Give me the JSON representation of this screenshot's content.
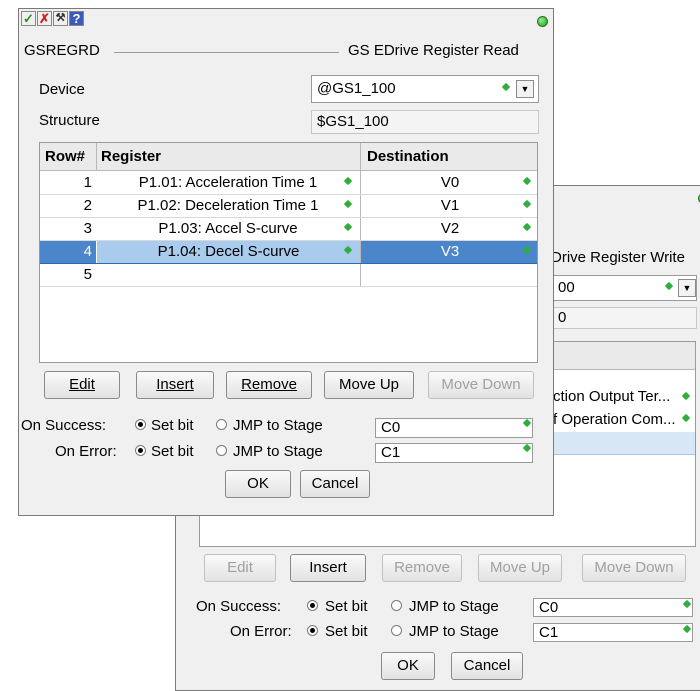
{
  "colors": {
    "accent": "#4a86c9",
    "status_green": "#2fae3c",
    "background": "#f0f0f0"
  },
  "back_dialog": {
    "title_partial": "Drive Register Write",
    "device_value": "00",
    "structure_value": "0",
    "rows": [
      {
        "register": "ction Output Ter..."
      },
      {
        "register": "f Operation Com..."
      }
    ],
    "buttons": {
      "edit": "Edit",
      "insert": "Insert",
      "remove": "Remove",
      "move_up": "Move Up",
      "move_down": "Move Down"
    },
    "on_success_label": "On Success:",
    "on_error_label": "On Error:",
    "set_bit": "Set bit",
    "jmp_to_stage": "JMP to Stage",
    "success_value": "C0",
    "error_value": "C1",
    "ok": "OK",
    "cancel": "Cancel"
  },
  "front_dialog": {
    "toolbar_icons": [
      "check-icon",
      "close-icon",
      "tools-icon",
      "help-icon"
    ],
    "toolbar_glyphs": {
      "check": "✓",
      "close": "✗",
      "tools": "⚒",
      "help": "?"
    },
    "instruction_name": "GSREGRD",
    "title": "GS EDrive Register Read",
    "device_label": "Device",
    "device_value": "@GS1_100",
    "structure_label": "Structure",
    "structure_value": "$GS1_100",
    "columns": {
      "row": "Row#",
      "register": "Register",
      "destination": "Destination"
    },
    "rows": [
      {
        "num": "1",
        "register": "P1.01: Acceleration Time 1",
        "destination": "V0"
      },
      {
        "num": "2",
        "register": "P1.02: Deceleration Time 1",
        "destination": "V1"
      },
      {
        "num": "3",
        "register": "P1.03: Accel S-curve",
        "destination": "V2"
      },
      {
        "num": "4",
        "register": "P1.04: Decel S-curve",
        "destination": "V3"
      },
      {
        "num": "5",
        "register": "",
        "destination": ""
      }
    ],
    "selected_row": "4",
    "buttons": {
      "edit": "Edit",
      "insert": "Insert",
      "remove": "Remove",
      "move_up": "Move Up",
      "move_down": "Move Down"
    },
    "on_success_label": "On Success:",
    "on_error_label": "On Error:",
    "set_bit": "Set bit",
    "jmp_to_stage": "JMP to Stage",
    "success_value": "C0",
    "error_value": "C1",
    "ok": "OK",
    "cancel": "Cancel"
  }
}
